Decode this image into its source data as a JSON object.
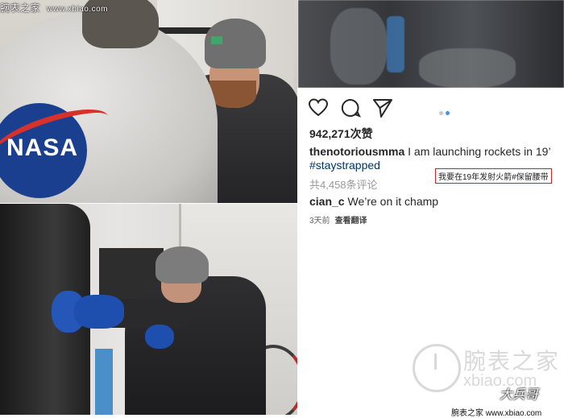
{
  "watermark_top": {
    "site": "腕表之家",
    "url": "www.xbiao.com"
  },
  "photo_top_left": {
    "patch_text": "NASA"
  },
  "instagram": {
    "likes": "942,271次赞",
    "username": "thenotoriousmma",
    "caption": "I am launching rockets in 19’",
    "hashtag": "#staystrapped",
    "comments_link": "共4,458条评论",
    "translation_box": "我要在19年发射火箭#保留腰带",
    "comment": {
      "user": "cian_c",
      "text": "We’re on it champ"
    },
    "comment_meta": {
      "time": "3天前",
      "translate": "查看翻译"
    },
    "carousel_dots": 2,
    "icons": [
      "heart-icon",
      "comment-icon",
      "share-icon"
    ]
  },
  "watermark_bottom": {
    "site": "腕表之家",
    "url": "xbiao.com",
    "signature": "大兵哥",
    "footer": "腕表之家 www.xbiao.com"
  },
  "colors": {
    "hashtag": "#003569",
    "translation_border": "#c8262a",
    "dot_active": "#3897f0",
    "dot_inactive": "#c7c7c7"
  }
}
